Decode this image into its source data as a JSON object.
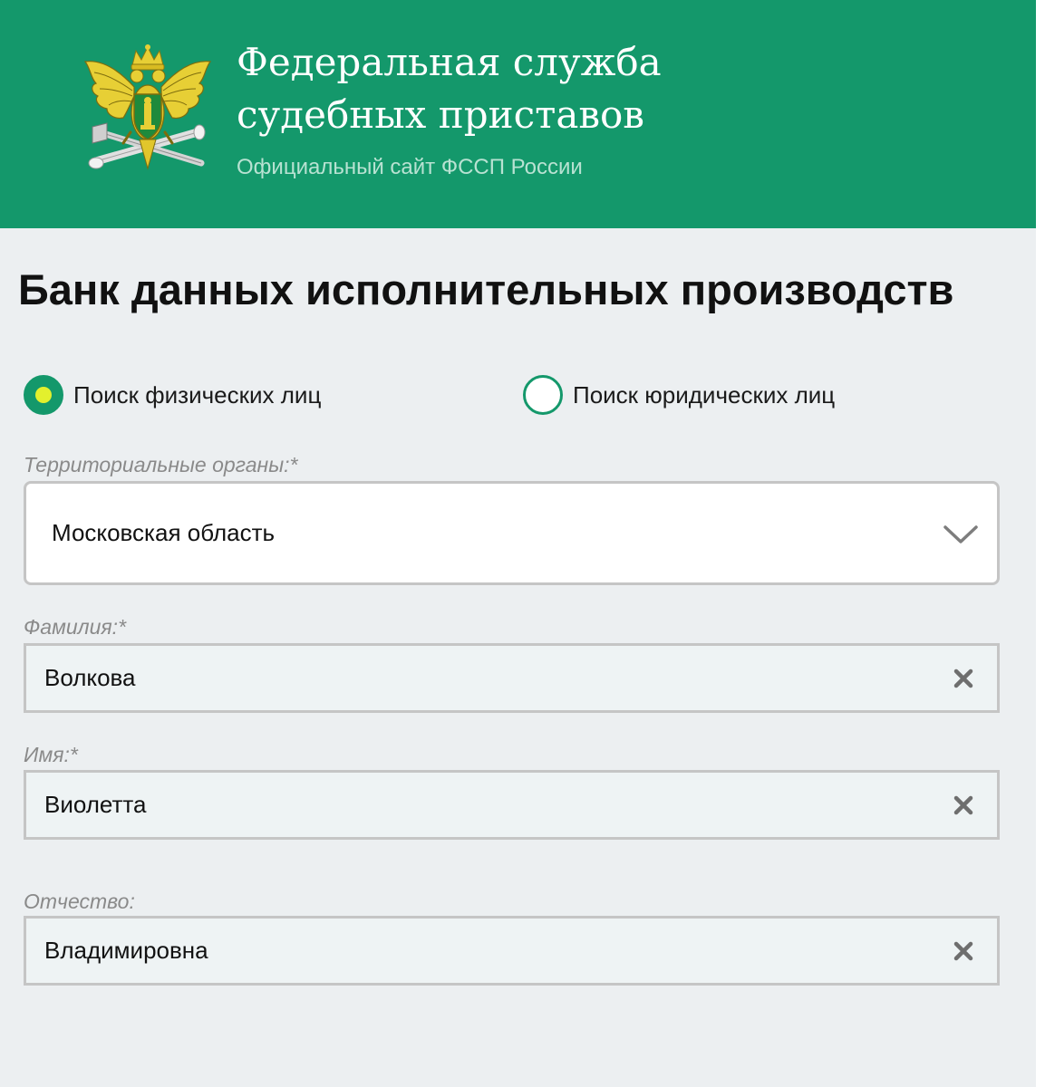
{
  "header": {
    "title_line1": "Федеральная служба",
    "title_line2": "судебных приставов",
    "subtitle": "Официальный сайт ФССП России",
    "background_color": "#14986b",
    "emblem_icon": "fssp-emblem-icon"
  },
  "page": {
    "title": "Банк данных исполнительных производств"
  },
  "search_type": {
    "options": [
      {
        "label": "Поиск физических лиц",
        "selected": true
      },
      {
        "label": "Поиск юридических лиц",
        "selected": false
      }
    ],
    "accent_color": "#14986b",
    "dot_color": "#e3f02d"
  },
  "form": {
    "region": {
      "label": "Территориальные органы:*",
      "value": "Московская область",
      "icon": "chevron-down-icon"
    },
    "last_name": {
      "label": "Фамилия:*",
      "value": "Волкова",
      "clear_icon": "clear-x-icon"
    },
    "first_name": {
      "label": "Имя:*",
      "value": "Виолетта",
      "clear_icon": "clear-x-icon"
    },
    "patronymic": {
      "label": "Отчество:",
      "value": "Владимировна",
      "clear_icon": "clear-x-icon"
    }
  }
}
